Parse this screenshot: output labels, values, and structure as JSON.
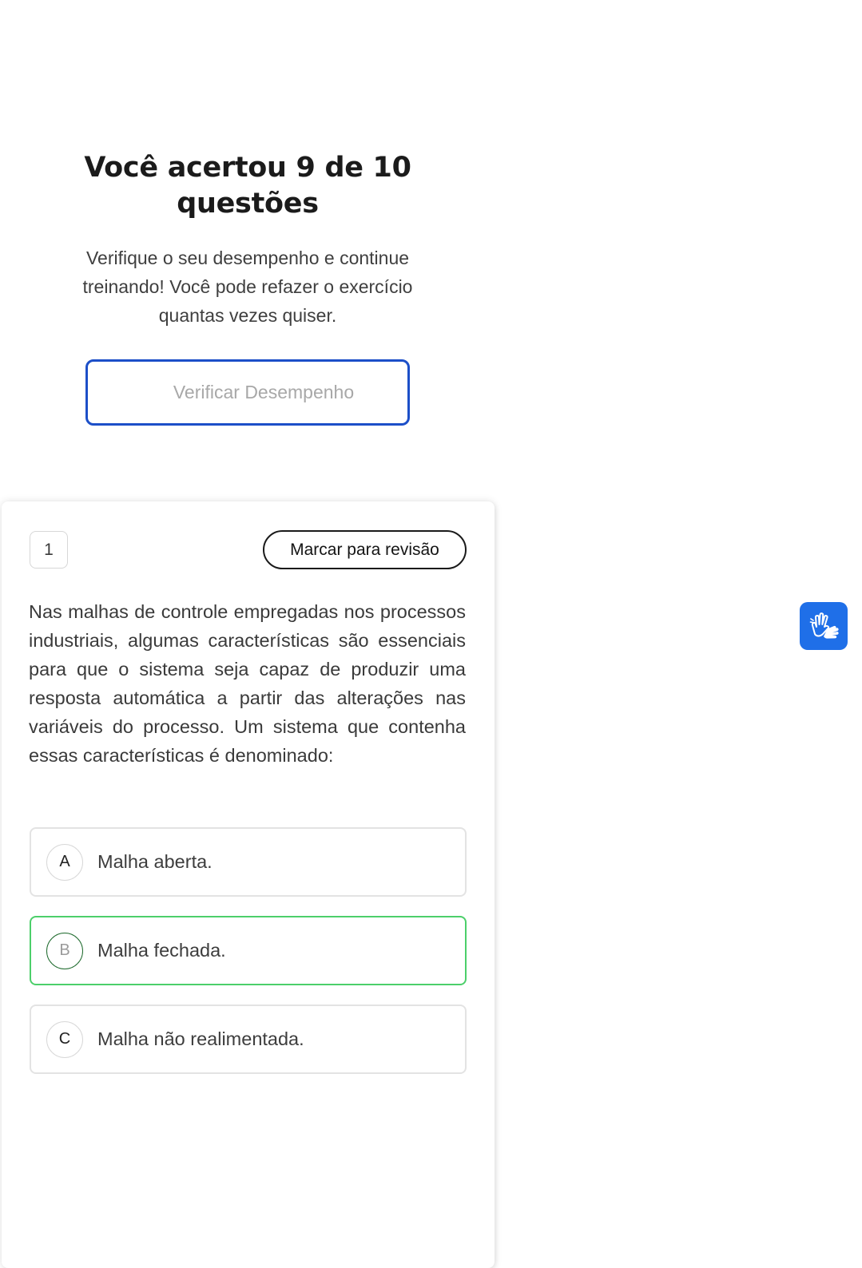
{
  "result": {
    "title": "Você acertou 9 de 10 questões",
    "subtitle": "Verifique o seu desempenho e continue treinando! Você pode refazer o exercício quantas vezes quiser.",
    "verify_button": "Verificar Desempenho"
  },
  "question": {
    "number": "1",
    "review_button": "Marcar para revisão",
    "text": "Nas malhas de controle empregadas nos processos industriais, algumas características são essenciais para que o sistema seja capaz de produzir uma resposta automática a partir das alterações nas variáveis do processo. Um sistema que contenha essas características é denominado:",
    "options": [
      {
        "letter": "A",
        "text": "Malha aberta."
      },
      {
        "letter": "B",
        "text": "Malha fechada.",
        "state": "correct"
      },
      {
        "letter": "C",
        "text": "Malha não realimentada."
      }
    ]
  },
  "widgets": {
    "accessibility_icon": "sign-language-hands-icon"
  },
  "colors": {
    "primary_blue": "#1c4fc8",
    "correct_green": "#4ccf6a",
    "widget_blue": "#1f6fe8"
  }
}
